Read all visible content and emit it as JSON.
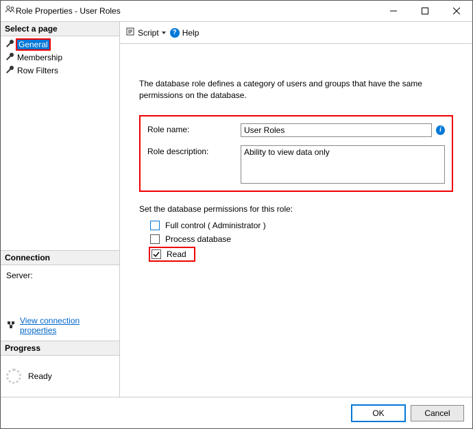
{
  "window": {
    "title": "Role Properties - User Roles"
  },
  "sidebar": {
    "select_page": "Select a page",
    "pages": [
      {
        "label": "General",
        "selected": true
      },
      {
        "label": "Membership",
        "selected": false
      },
      {
        "label": "Row Filters",
        "selected": false
      }
    ],
    "connection_header": "Connection",
    "server_label": "Server:",
    "view_conn": "View connection properties",
    "progress_header": "Progress",
    "progress_status": "Ready"
  },
  "toolbar": {
    "script": "Script",
    "help": "Help"
  },
  "main": {
    "intro": "The database role defines a category of users and groups that have the same permissions on the database.",
    "role_name_label": "Role name:",
    "role_name_value": "User Roles",
    "role_desc_label": "Role description:",
    "role_desc_value": "Ability to view data only",
    "perm_header": "Set the database permissions for this role:",
    "perm_full": "Full control ( Administrator )",
    "perm_process": "Process database",
    "perm_read": "Read"
  },
  "footer": {
    "ok": "OK",
    "cancel": "Cancel"
  }
}
